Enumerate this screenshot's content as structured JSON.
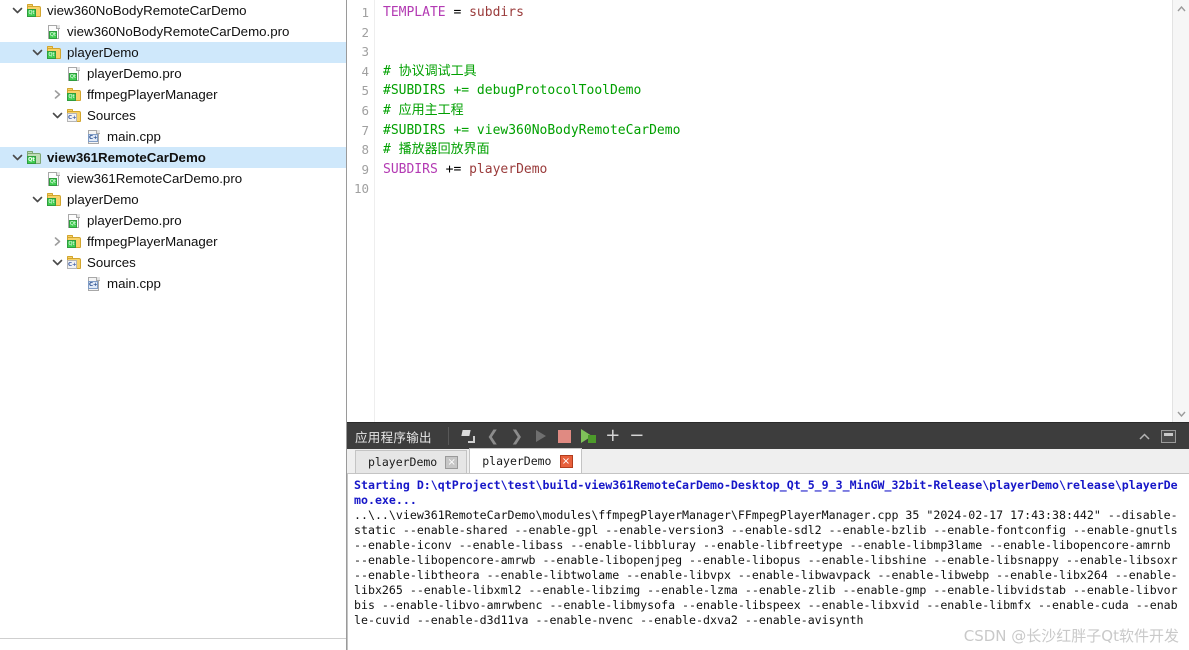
{
  "sidebar": {
    "name": "project-tree",
    "items": [
      {
        "label": "view360NoBodyRemoteCarDemo",
        "indent": 0,
        "arrow": "down",
        "icon": "qt-project-folder-icon",
        "selected": false,
        "bold": false
      },
      {
        "label": "view360NoBodyRemoteCarDemo.pro",
        "indent": 1,
        "arrow": "none",
        "icon": "qt-pro-file-icon",
        "selected": false,
        "bold": false
      },
      {
        "label": "playerDemo",
        "indent": 1,
        "arrow": "down",
        "icon": "qt-project-folder-icon",
        "selected": true,
        "bold": false
      },
      {
        "label": "playerDemo.pro",
        "indent": 2,
        "arrow": "none",
        "icon": "qt-pro-file-icon",
        "selected": false,
        "bold": false
      },
      {
        "label": "ffmpegPlayerManager",
        "indent": 2,
        "arrow": "right",
        "icon": "qt-project-folder-icon",
        "selected": false,
        "bold": false
      },
      {
        "label": "Sources",
        "indent": 2,
        "arrow": "down",
        "icon": "cpp-sources-folder-icon",
        "selected": false,
        "bold": false
      },
      {
        "label": "main.cpp",
        "indent": 3,
        "arrow": "none",
        "icon": "cpp-file-icon",
        "selected": false,
        "bold": false
      },
      {
        "label": "view361RemoteCarDemo",
        "indent": 0,
        "arrow": "down",
        "icon": "qt-project-folder-active-icon",
        "selected": true,
        "bold": true
      },
      {
        "label": "view361RemoteCarDemo.pro",
        "indent": 1,
        "arrow": "none",
        "icon": "qt-pro-file-icon",
        "selected": false,
        "bold": false
      },
      {
        "label": "playerDemo",
        "indent": 1,
        "arrow": "down",
        "icon": "qt-project-folder-icon",
        "selected": false,
        "bold": false
      },
      {
        "label": "playerDemo.pro",
        "indent": 2,
        "arrow": "none",
        "icon": "qt-pro-file-icon",
        "selected": false,
        "bold": false
      },
      {
        "label": "ffmpegPlayerManager",
        "indent": 2,
        "arrow": "right",
        "icon": "qt-project-folder-icon",
        "selected": false,
        "bold": false
      },
      {
        "label": "Sources",
        "indent": 2,
        "arrow": "down",
        "icon": "cpp-sources-folder-icon",
        "selected": false,
        "bold": false
      },
      {
        "label": "main.cpp",
        "indent": 3,
        "arrow": "none",
        "icon": "cpp-file-icon",
        "selected": false,
        "bold": false
      }
    ]
  },
  "editor": {
    "line_numbers": [
      "1",
      "2",
      "3",
      "4",
      "5",
      "6",
      "7",
      "8",
      "9",
      "10"
    ],
    "lines": [
      {
        "num": "1",
        "tokens": [
          {
            "t": "TEMPLATE",
            "c": "kw"
          },
          {
            "t": " = ",
            "c": "op"
          },
          {
            "t": "subdirs",
            "c": "val"
          }
        ]
      },
      {
        "num": "2",
        "tokens": []
      },
      {
        "num": "3",
        "tokens": []
      },
      {
        "num": "4",
        "tokens": [
          {
            "t": "# 协议调试工具",
            "c": "cmt"
          }
        ]
      },
      {
        "num": "5",
        "tokens": [
          {
            "t": "#SUBDIRS += debugProtocolToolDemo",
            "c": "cmt"
          }
        ]
      },
      {
        "num": "6",
        "tokens": [
          {
            "t": "# 应用主工程",
            "c": "cmt"
          }
        ]
      },
      {
        "num": "7",
        "tokens": [
          {
            "t": "#SUBDIRS += view360NoBodyRemoteCarDemo",
            "c": "cmt"
          }
        ]
      },
      {
        "num": "8",
        "tokens": [
          {
            "t": "# 播放器回放界面",
            "c": "cmt"
          }
        ]
      },
      {
        "num": "9",
        "tokens": [
          {
            "t": "SUBDIRS",
            "c": "kw"
          },
          {
            "t": " += ",
            "c": "op"
          },
          {
            "t": "playerDemo",
            "c": "val"
          }
        ]
      },
      {
        "num": "10",
        "tokens": []
      }
    ]
  },
  "output_panel": {
    "title": "应用程序输出",
    "toolbar": [
      {
        "name": "clear-output-button",
        "icon": "broom-icon",
        "enabled": true
      },
      {
        "name": "prev-item-button",
        "icon": "chevron-left-icon",
        "enabled": false
      },
      {
        "name": "next-item-button",
        "icon": "chevron-right-icon",
        "enabled": false
      },
      {
        "name": "run-button",
        "icon": "play-icon",
        "enabled": false
      },
      {
        "name": "stop-button",
        "icon": "stop-square-icon",
        "enabled": true
      },
      {
        "name": "rerun-button",
        "icon": "play-green-icon",
        "enabled": true
      },
      {
        "name": "zoom-in-button",
        "icon": "plus-icon",
        "enabled": true
      },
      {
        "name": "zoom-out-button",
        "icon": "minus-icon",
        "enabled": true
      }
    ],
    "header_right": [
      {
        "name": "collapse-chevron-icon",
        "icon": "chevron-up-icon"
      },
      {
        "name": "minimize-panel-button",
        "icon": "minimize-window-icon"
      }
    ],
    "tabs": [
      {
        "label": "playerDemo",
        "active": false,
        "close_state": "gray"
      },
      {
        "label": "playerDemo",
        "active": true,
        "close_state": "red"
      }
    ],
    "content": [
      {
        "style": "start",
        "text": "Starting D:\\qtProject\\test\\build-view361RemoteCarDemo-Desktop_Qt_5_9_3_MinGW_32bit-Release\\playerDemo\\release\\playerDemo.exe..."
      },
      {
        "style": "norm",
        "text": "..\\..\\view361RemoteCarDemo\\modules\\ffmpegPlayerManager\\FFmpegPlayerManager.cpp 35 \"2024-02-17 17:43:38:442\" --disable-static --enable-shared --enable-gpl --enable-version3 --enable-sdl2 --enable-bzlib --enable-fontconfig --enable-gnutls --enable-iconv --enable-libass --enable-libbluray --enable-libfreetype --enable-libmp3lame --enable-libopencore-amrnb --enable-libopencore-amrwb --enable-libopenjpeg --enable-libopus --enable-libshine --enable-libsnappy --enable-libsoxr --enable-libtheora --enable-libtwolame --enable-libvpx --enable-libwavpack --enable-libwebp --enable-libx264 --enable-libx265 --enable-libxml2 --enable-libzimg --enable-lzma --enable-zlib --enable-gmp --enable-libvidstab --enable-libvorbis --enable-libvo-amrwbenc --enable-libmysofa --enable-libspeex --enable-libxvid --enable-libmfx --enable-cuda --enable-cuvid --enable-d3d11va --enable-nvenc --enable-dxva2 --enable-avisynth"
      }
    ]
  },
  "watermark": {
    "text": "CSDN @长沙红胖子Qt软件开发"
  },
  "colors": {
    "selection_blue": "#cfe8fb",
    "panel_dark": "#3d3d3d",
    "output_link_blue": "#1616c8",
    "comment_green": "#00a000",
    "keyword_magenta": "#b33ab3",
    "value_maroon": "#9a3b3b",
    "qt_green": "#41cd52",
    "stop_red": "#e08a82"
  }
}
